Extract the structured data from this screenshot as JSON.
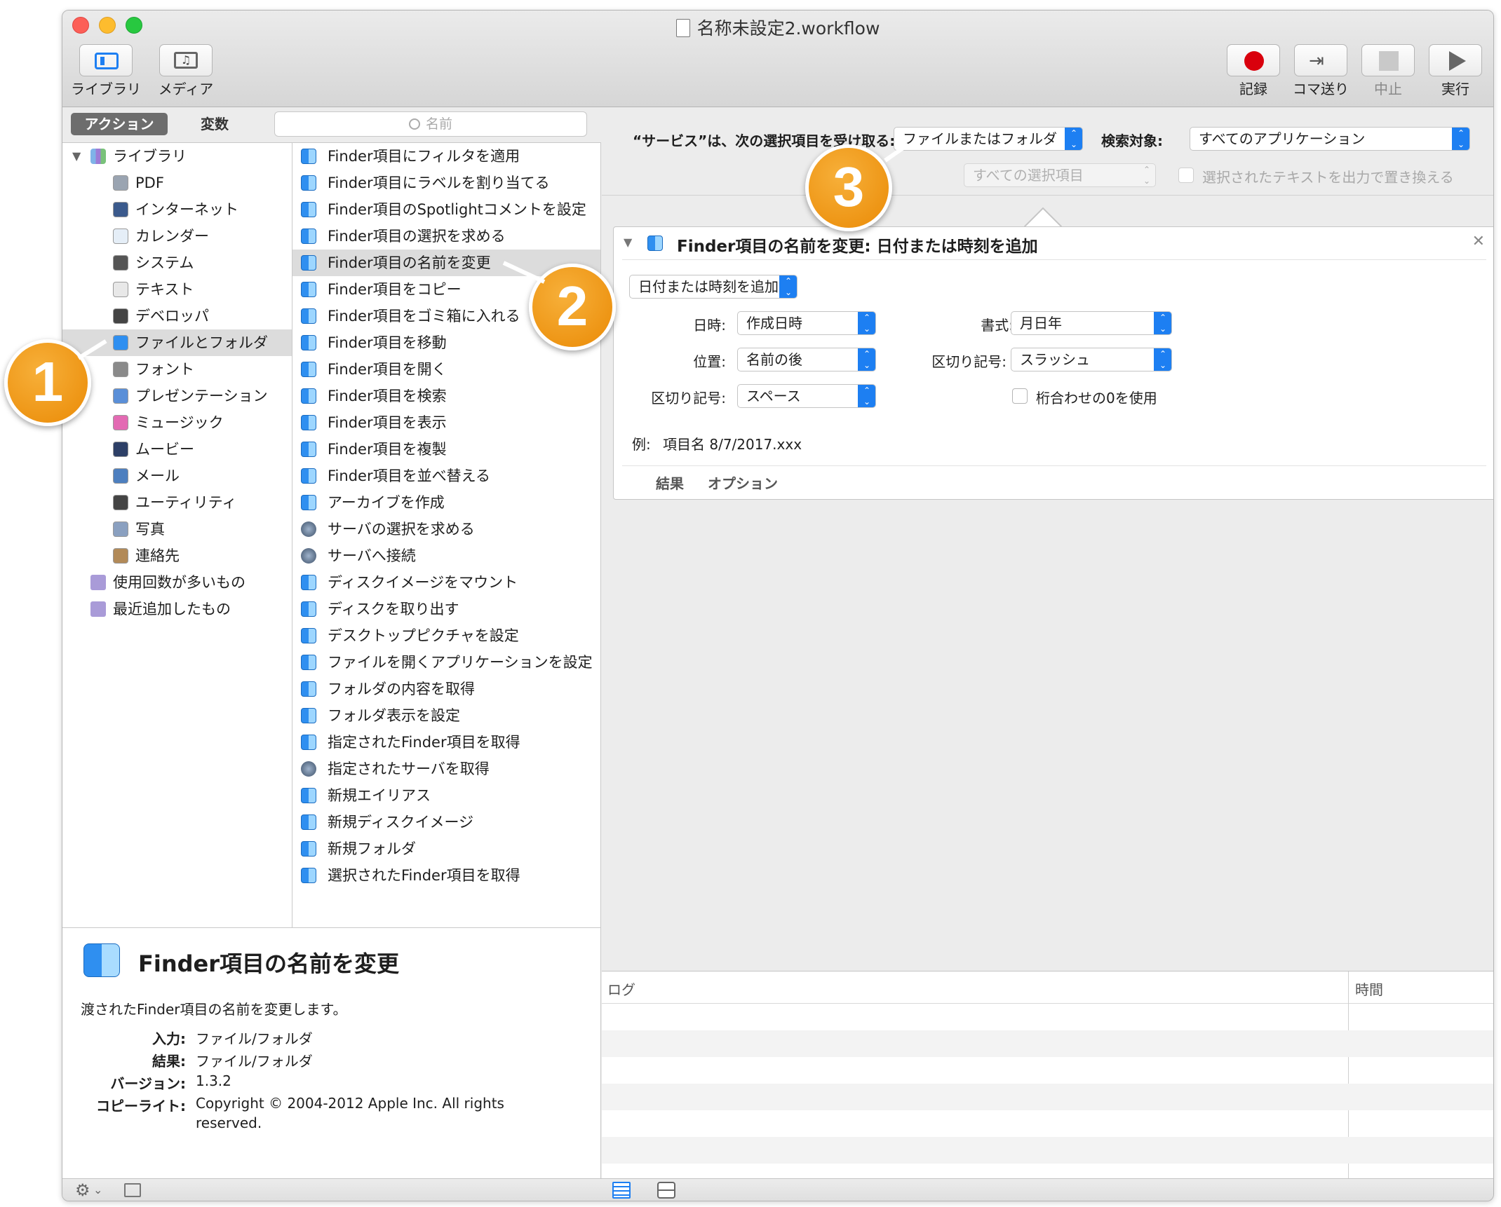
{
  "window": {
    "title": "名称未設定2.workflow"
  },
  "toolbar": {
    "library_label": "ライブラリ",
    "media_label": "メディア",
    "record_label": "記録",
    "step_label": "コマ送り",
    "stop_label": "中止",
    "run_label": "実行"
  },
  "tabs": {
    "actions": "アクション",
    "variables": "変数"
  },
  "search": {
    "placeholder": "名前"
  },
  "library": {
    "root": "ライブラリ",
    "items": [
      "PDF",
      "インターネット",
      "カレンダー",
      "システム",
      "テキスト",
      "デベロッパ",
      "ファイルとフォルダ",
      "フォント",
      "プレゼンテーション",
      "ミュージック",
      "ムービー",
      "メール",
      "ユーティリティ",
      "写真",
      "連絡先"
    ],
    "smart": [
      "使用回数が多いもの",
      "最近追加したもの"
    ]
  },
  "actions": [
    "Finder項目にフィルタを適用",
    "Finder項目にラベルを割り当てる",
    "Finder項目のSpotlightコメントを設定",
    "Finder項目の選択を求める",
    "Finder項目の名前を変更",
    "Finder項目をコピー",
    "Finder項目をゴミ箱に入れる",
    "Finder項目を移動",
    "Finder項目を開く",
    "Finder項目を検索",
    "Finder項目を表示",
    "Finder項目を複製",
    "Finder項目を並べ替える",
    "アーカイブを作成",
    "サーバの選択を求める",
    "サーバへ接続",
    "ディスクイメージをマウント",
    "ディスクを取り出す",
    "デスクトップピクチャを設定",
    "ファイルを開くアプリケーションを設定",
    "フォルダの内容を取得",
    "フォルダ表示を設定",
    "指定されたFinder項目を取得",
    "指定されたサーバを取得",
    "新規エイリアス",
    "新規ディスクイメージ",
    "新規フォルダ",
    "選択されたFinder項目を取得"
  ],
  "info": {
    "title": "Finder項目の名前を変更",
    "description": "渡されたFinder項目の名前を変更します。",
    "input_label": "入力:",
    "input_value": "ファイル/フォルダ",
    "result_label": "結果:",
    "result_value": "ファイル/フォルダ",
    "version_label": "バージョン:",
    "version_value": "1.3.2",
    "copyright_label": "コピーライト:",
    "copyright_value_1": "Copyright © 2004-2012 Apple Inc.  All rights",
    "copyright_value_2": "reserved."
  },
  "service": {
    "receives_label": "“サービス”は、次の選択項目を受け取る:",
    "receives_value": "ファイルまたはフォルダ",
    "in_label": "検索対象:",
    "in_value": "すべてのアプリケーション",
    "selection_value": "すべての選択項目",
    "replace_label": "選択されたテキストを出力で置き換える"
  },
  "action_box": {
    "title": "Finder項目の名前を変更: 日付または時刻を追加",
    "mode": "日付または時刻を追加",
    "date_label": "日時:",
    "date_value": "作成日時",
    "format_label": "書式:",
    "format_value": "月日年",
    "position_label": "位置:",
    "position_value": "名前の後",
    "separator_label": "区切り記号:",
    "separator_value": "スラッシュ",
    "sep2_label": "区切り記号:",
    "sep2_value": "スペース",
    "zero_label": "桁合わせの0を使用",
    "example_label": "例:",
    "example_value": "項目名 8/7/2017.xxx",
    "tab_results": "結果",
    "tab_options": "オプション"
  },
  "log": {
    "col_log": "ログ",
    "col_time": "時間"
  },
  "badges": [
    "1",
    "2",
    "3"
  ]
}
